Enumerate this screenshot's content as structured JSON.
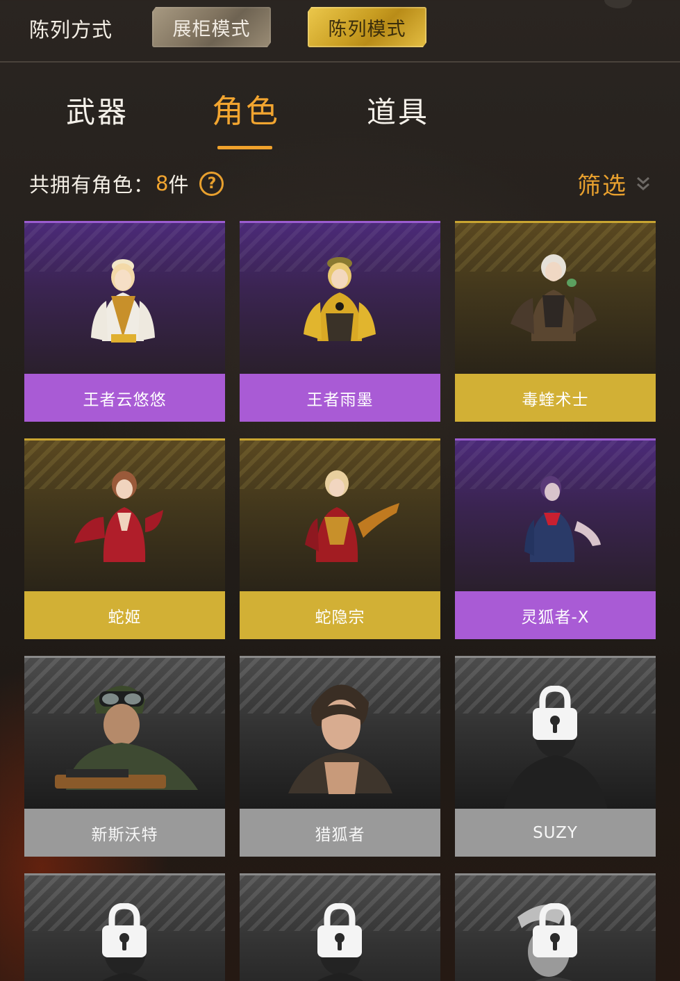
{
  "header": {
    "title": "陈列方式",
    "mode_cabinet": "展柜模式",
    "mode_display": "陈列模式"
  },
  "tabs": [
    {
      "label": "武器",
      "active": false
    },
    {
      "label": "角色",
      "active": true
    },
    {
      "label": "道具",
      "active": false
    }
  ],
  "summary": {
    "label": "共拥有角色：",
    "count": "8",
    "unit": "件",
    "help_icon": "question-circle-icon"
  },
  "filter": {
    "label": "筛选",
    "icon": "double-chevron-down-icon"
  },
  "colors": {
    "accent": "#f2a530",
    "purple_rarity": "#a95bd5",
    "gold_rarity": "#d2b035",
    "locked": "#9a9a9a"
  },
  "characters": [
    {
      "name": "王者云悠悠",
      "rarity": "purple",
      "locked": false,
      "figure": "white-gold-uniform"
    },
    {
      "name": "王者雨墨",
      "rarity": "purple",
      "locked": false,
      "figure": "gold-armor"
    },
    {
      "name": "毒蝰术士",
      "rarity": "gold",
      "locked": false,
      "figure": "dark-leather"
    },
    {
      "name": "蛇姬",
      "rarity": "gold",
      "locked": false,
      "figure": "red-suit"
    },
    {
      "name": "蛇隐宗",
      "rarity": "gold",
      "locked": false,
      "figure": "red-gold-armor"
    },
    {
      "name": "灵狐者-X",
      "rarity": "purple",
      "locked": false,
      "figure": "navy-dress"
    },
    {
      "name": "新斯沃特",
      "rarity": "grey",
      "locked": false,
      "figure": "soldier-goggles"
    },
    {
      "name": "猎狐者",
      "rarity": "grey",
      "locked": false,
      "figure": "short-hair-girl"
    },
    {
      "name": "SUZY",
      "rarity": "grey",
      "locked": true,
      "figure": "silhouette"
    },
    {
      "name": "",
      "rarity": "grey",
      "locked": true,
      "figure": "silhouette"
    },
    {
      "name": "",
      "rarity": "grey",
      "locked": true,
      "figure": "silhouette"
    },
    {
      "name": "",
      "rarity": "grey",
      "locked": true,
      "figure": "silhouette"
    }
  ]
}
